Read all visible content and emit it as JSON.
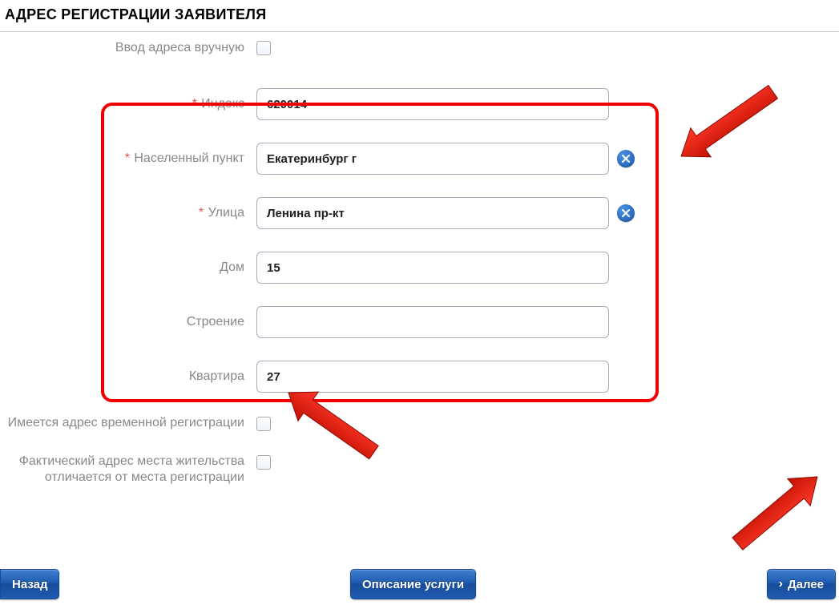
{
  "header": {
    "title": "АДРЕС РЕГИСТРАЦИИ ЗАЯВИТЕЛЯ"
  },
  "form": {
    "manual_label": "Ввод адреса вручную",
    "index_label": "Индекс",
    "index_value": "620014",
    "locality_label": "Населенный пункт",
    "locality_value": "Екатеринбург г",
    "street_label": "Улица",
    "street_value": "Ленина пр-кт",
    "house_label": "Дом",
    "house_value": "15",
    "building_label": "Строение",
    "building_value": "",
    "flat_label": "Квартира",
    "flat_value": "27",
    "temp_reg_label": "Имеется адрес временной регистрации",
    "actual_addr_label": "Фактический адрес места жительства отличается от места регистрации"
  },
  "buttons": {
    "back": "Назад",
    "desc": "Описание услуги",
    "next": "Далее"
  }
}
